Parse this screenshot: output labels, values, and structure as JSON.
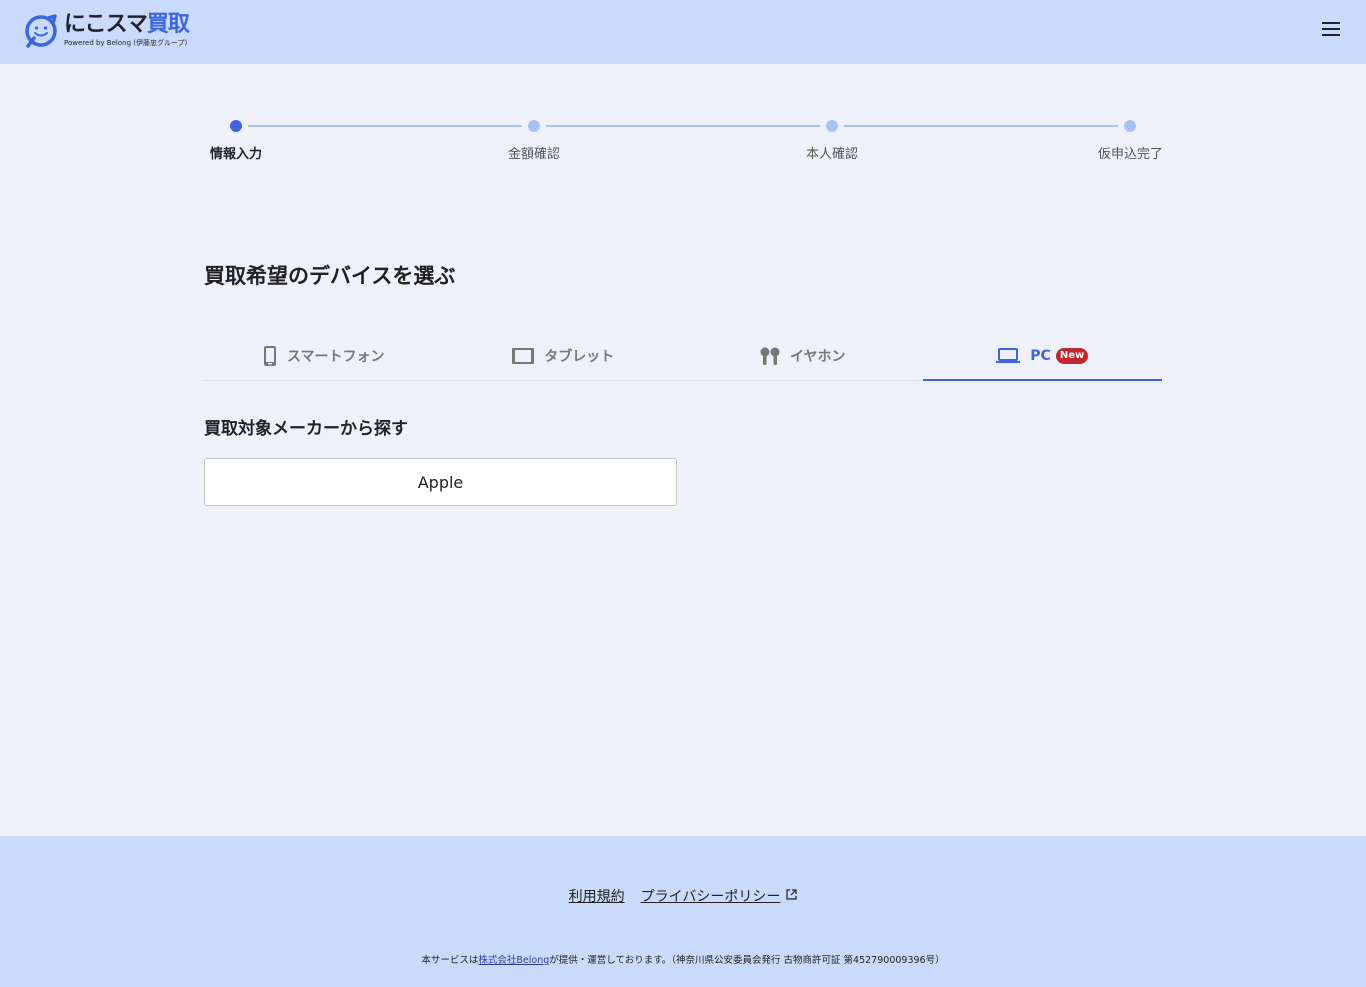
{
  "header": {
    "logo_main_dark": "にこスマ",
    "logo_main_blue": "買取",
    "logo_sub": "Powered by Belong (伊藤忠グループ)"
  },
  "stepper": {
    "steps": [
      "情報入力",
      "金額確認",
      "本人確認",
      "仮申込完了"
    ],
    "active_index": 0
  },
  "section_title": "買取希望のデバイスを選ぶ",
  "tabs": [
    {
      "label": "スマートフォン",
      "icon": "smartphone-icon"
    },
    {
      "label": "タブレット",
      "icon": "tablet-icon"
    },
    {
      "label": "イヤホン",
      "icon": "earphones-icon"
    },
    {
      "label": "PC",
      "icon": "laptop-icon",
      "badge": "New"
    }
  ],
  "active_tab": "PC",
  "maker": {
    "title": "買取対象メーカーから探す",
    "options": [
      "Apple"
    ]
  },
  "footer": {
    "links": [
      "利用規約",
      "プライバシーポリシー"
    ],
    "note_prefix": "本サービスは",
    "note_link": "株式会社Belong",
    "note_suffix": "が提供・運営しております。（神奈川県公安委員会発行 古物商許可証 第452790009396号）"
  },
  "colors": {
    "accent": "#3b66e0",
    "header_bg": "#c9dafa",
    "page_bg": "#eff1fa",
    "badge": "#c1272d"
  }
}
